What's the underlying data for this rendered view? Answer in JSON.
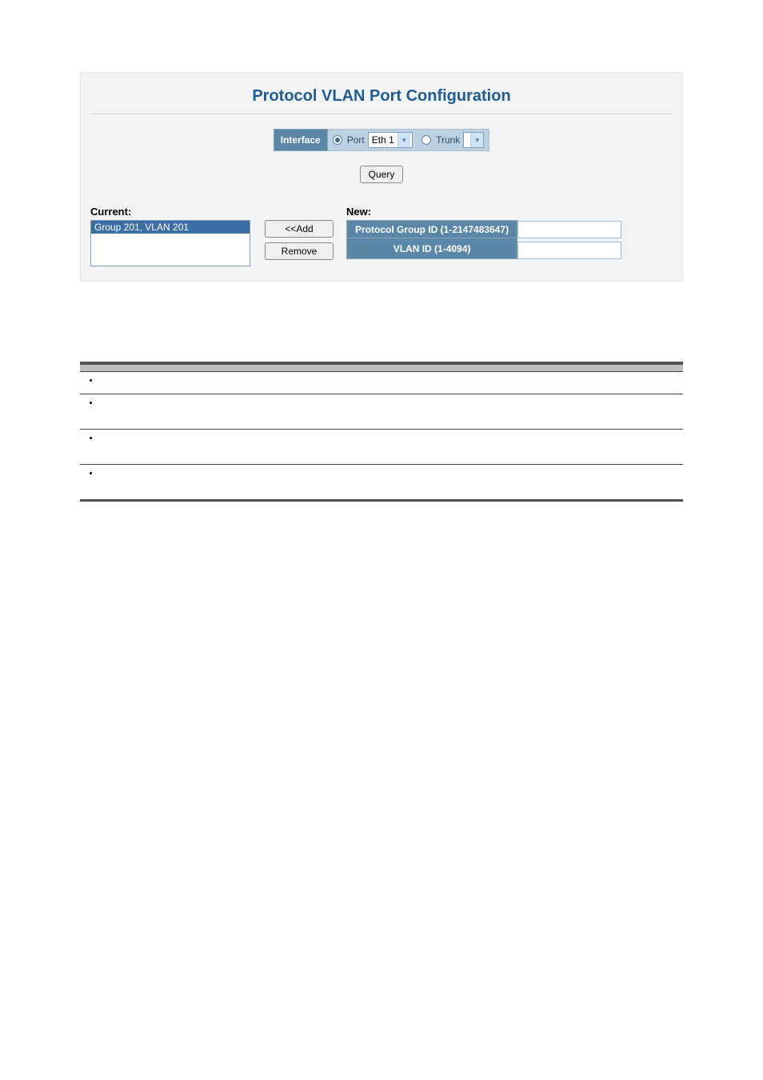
{
  "panel": {
    "title": "Protocol VLAN Port Configuration",
    "interface": {
      "label": "Interface",
      "port_radio_label": "Port",
      "port_select_value": "Eth 1",
      "trunk_radio_label": "Trunk",
      "trunk_select_value": ""
    },
    "buttons": {
      "query": "Query",
      "add": "<<Add",
      "remove": "Remove"
    },
    "current": {
      "label": "Current:",
      "items": [
        "Group 201, VLAN 201"
      ]
    },
    "new": {
      "label": "New:",
      "fields": {
        "group_id_label": "Protocol Group ID (1-2147483647)",
        "vlan_id_label": "VLAN ID (1-4094)"
      }
    }
  },
  "cli_table": {
    "headers": [
      "",
      ""
    ],
    "rows": [
      {
        "bullet": "•"
      },
      {
        "bullet": "•"
      },
      {
        "bullet": "•"
      },
      {
        "bullet": "•"
      }
    ]
  }
}
